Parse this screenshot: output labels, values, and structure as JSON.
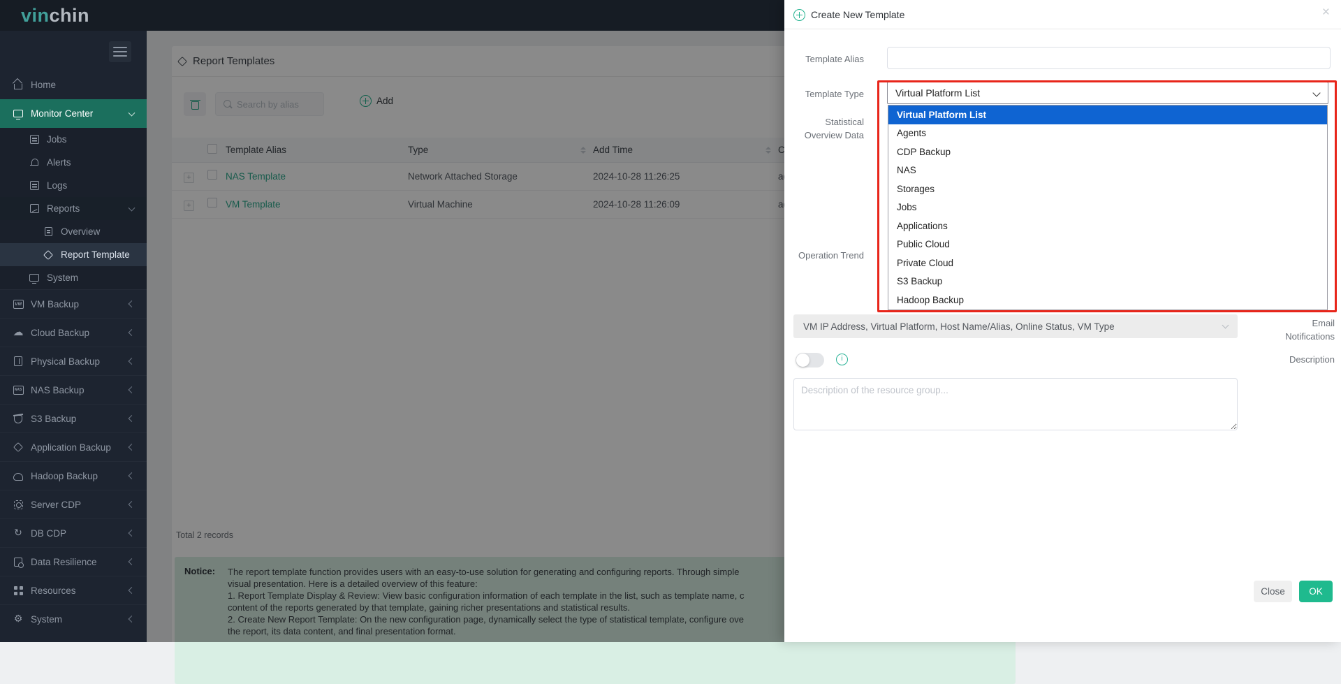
{
  "colors": {
    "accent_teal": "#23b28f",
    "sidebar_active_teal": "#1b6f5d",
    "table_link_teal": "#2da88c",
    "dropdown_selected_blue": "#0f64d2",
    "annotation_red": "#e8251a",
    "ok_button_green": "#1fba8e",
    "topbar_dark": "#161c24",
    "sidebar_dark": "#1d2430"
  },
  "topbar": {
    "logo_part1": "vin",
    "logo_part2": "chin"
  },
  "sidebar": {
    "items": [
      {
        "label": "Home"
      },
      {
        "label": "Monitor Center"
      },
      {
        "label": "Jobs"
      },
      {
        "label": "Alerts"
      },
      {
        "label": "Logs"
      },
      {
        "label": "Reports"
      },
      {
        "label": "Overview"
      },
      {
        "label": "Report Template"
      },
      {
        "label": "System"
      },
      {
        "label": "VM Backup"
      },
      {
        "label": "Cloud Backup"
      },
      {
        "label": "Physical Backup"
      },
      {
        "label": "NAS Backup"
      },
      {
        "label": "S3 Backup"
      },
      {
        "label": "Application Backup"
      },
      {
        "label": "Hadoop Backup"
      },
      {
        "label": "Server CDP"
      },
      {
        "label": "DB CDP"
      },
      {
        "label": "Data Resilience"
      },
      {
        "label": "Resources"
      },
      {
        "label": "System"
      }
    ]
  },
  "content": {
    "title": "Report Templates",
    "toolbar": {
      "search_placeholder": "Search by alias",
      "add_label": "Add"
    },
    "table": {
      "headers": {
        "alias": "Template Alias",
        "type": "Type",
        "add_time": "Add Time",
        "creator": "Cr"
      },
      "rows": [
        {
          "alias": "NAS Template",
          "type": "Network Attached Storage",
          "add_time": "2024-10-28 11:26:25",
          "creator": "ad"
        },
        {
          "alias": "VM Template",
          "type": "Virtual Machine",
          "add_time": "2024-10-28 11:26:09",
          "creator": "ad"
        }
      ]
    },
    "total_records": "Total 2 records",
    "notice": {
      "label": "Notice:",
      "lines": [
        "The report template function provides users with an easy-to-use solution for generating and configuring reports. Through simple",
        "visual presentation. Here is a detailed overview of this feature:",
        "1. Report Template Display & Review: View basic configuration information of each template in the list, such as template name, c",
        "content of the reports generated by that template, gaining richer presentations and statistical results.",
        "2. Create New Report Template: On the new configuration page, dynamically select the type of statistical template, configure ove",
        "the report, its data content, and final presentation format."
      ]
    }
  },
  "modal": {
    "title": "Create New Template",
    "close_icon": "×",
    "labels": {
      "template_alias": "Template Alias",
      "template_type": "Template Type",
      "statistical_overview": "Statistical Overview Data",
      "operation_trend": "Operation Trend",
      "email_notifications": "Email Notifications",
      "description": "Description"
    },
    "template_alias_value": "",
    "template_type_value": "Virtual Platform List",
    "dropdown_options": [
      "Virtual Platform List",
      "Agents",
      "CDP Backup",
      "NAS",
      "Storages",
      "Jobs",
      "Applications",
      "Public Cloud",
      "Private Cloud",
      "S3 Backup",
      "Hadoop Backup"
    ],
    "selected_option": "Virtual Platform List",
    "overview_items_value": "VM IP Address, Virtual Platform, Host Name/Alias, Online Status, VM Type",
    "description_placeholder": "Description of the resource group...",
    "info_icon_glyph": "i",
    "footer": {
      "close": "Close",
      "ok": "OK"
    }
  }
}
